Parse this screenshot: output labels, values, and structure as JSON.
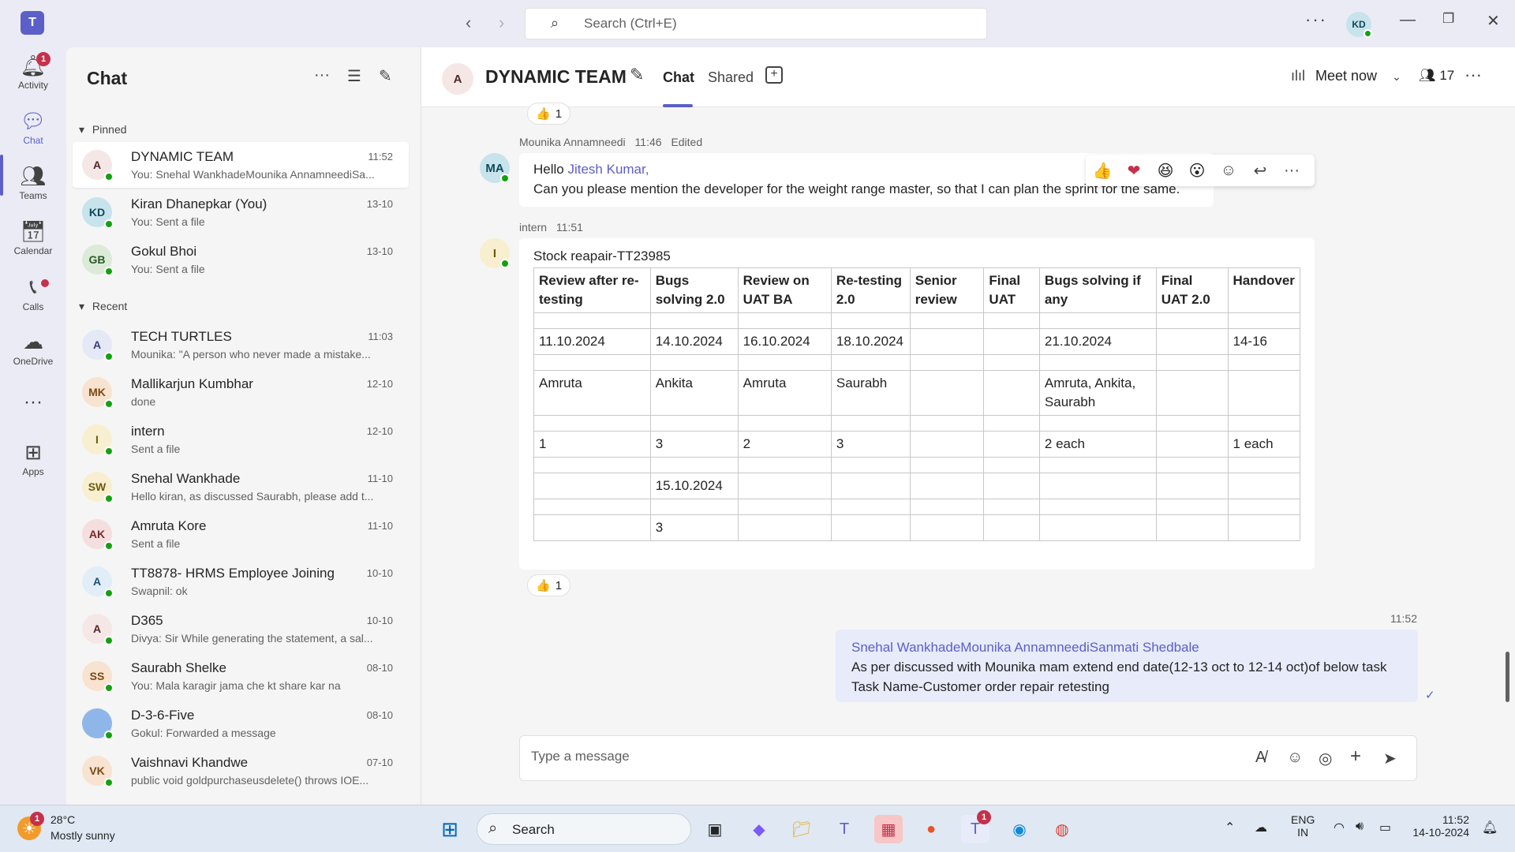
{
  "titlebar": {
    "search_placeholder": "Search (Ctrl+E)",
    "user_initials": "KD"
  },
  "rail": {
    "items": [
      {
        "label": "Activity",
        "badge": "1"
      },
      {
        "label": "Chat"
      },
      {
        "label": "Teams"
      },
      {
        "label": "Calendar"
      },
      {
        "label": "Calls"
      },
      {
        "label": "OneDrive"
      },
      {
        "label": "Apps"
      }
    ]
  },
  "chatlist": {
    "title": "Chat",
    "pinned_label": "Pinned",
    "recent_label": "Recent",
    "pinned": [
      {
        "initials": "A",
        "name": "DYNAMIC TEAM",
        "preview": "You: Snehal WankhadeMounika AnnamneediSa...",
        "time": "11:52",
        "bg": "#f6e7e7",
        "fg": "#4d2a2a"
      },
      {
        "initials": "KD",
        "name": "Kiran Dhanepkar (You)",
        "preview": "You: Sent a file",
        "time": "13-10",
        "bg": "#c7e3eb",
        "fg": "#0f4a5c"
      },
      {
        "initials": "GB",
        "name": "Gokul Bhoi",
        "preview": "You: Sent a file",
        "time": "13-10",
        "bg": "#dbebd8",
        "fg": "#2d5a27"
      }
    ],
    "recent": [
      {
        "initials": "A",
        "name": "TECH TURTLES",
        "preview": "Mounika: \"A person who never made a mistake...",
        "time": "11:03",
        "bg": "#e5e8f5",
        "fg": "#3b3f7a"
      },
      {
        "initials": "MK",
        "name": "Mallikarjun Kumbhar",
        "preview": "done",
        "time": "12-10",
        "bg": "#f7e3cf",
        "fg": "#7a4a14"
      },
      {
        "initials": "I",
        "name": "intern",
        "preview": "Sent a file",
        "time": "12-10",
        "bg": "#f7efcf",
        "fg": "#6e5a10"
      },
      {
        "initials": "SW",
        "name": "Snehal Wankhade",
        "preview": "Hello kiran, as discussed Saurabh, please add t...",
        "time": "11-10",
        "bg": "#f7efcf",
        "fg": "#6e5a10"
      },
      {
        "initials": "AK",
        "name": "Amruta Kore",
        "preview": "Sent a file",
        "time": "11-10",
        "bg": "#f5dede",
        "fg": "#7a2a2a"
      },
      {
        "initials": "A",
        "name": "TT8878- HRMS Employee Joining",
        "preview": "Swapnil: ok",
        "time": "10-10",
        "bg": "#e2eef7",
        "fg": "#1f4e7a"
      },
      {
        "initials": "A",
        "name": "D365",
        "preview": "Divya: Sir While generating the statement, a sal...",
        "time": "10-10",
        "bg": "#f6e7e7",
        "fg": "#4d2a2a"
      },
      {
        "initials": "SS",
        "name": "Saurabh Shelke",
        "preview": "You: Mala karagir jama che kt share kar na",
        "time": "08-10",
        "bg": "#f7e3cf",
        "fg": "#7a4a14"
      },
      {
        "initials": "",
        "name": "D-3-6-Five",
        "preview": "Gokul: Forwarded a message",
        "time": "08-10",
        "bg": "#8fb6e8",
        "fg": "#ffffff"
      },
      {
        "initials": "VK",
        "name": "Vaishnavi Khandwe",
        "preview": "public void goldpurchaseusdelete() throws IOE...",
        "time": "07-10",
        "bg": "#f7e3cf",
        "fg": "#7a4a14"
      }
    ]
  },
  "header": {
    "group_initial": "A",
    "group_name": "DYNAMIC TEAM",
    "tab_chat": "Chat",
    "tab_shared": "Shared",
    "meet_now": "Meet now",
    "participants": "17"
  },
  "messages": {
    "top_reaction_count": "1",
    "msg1": {
      "author": "Mounika Annamneedi",
      "time": "11:46",
      "edited": "Edited",
      "initials": "MA",
      "greeting": "Hello ",
      "mention": "Jitesh Kumar",
      "comma": ",",
      "body": "Can you please mention the developer for the weight range master, so that I can plan the sprint for the same."
    },
    "msg2": {
      "author": "intern",
      "time": "11:51",
      "initials": "I",
      "title": "Stock reapair-TT23985",
      "reaction_count": "1",
      "table_headers": [
        "Review after re-testing",
        "Bugs solving 2.0",
        "Review on UAT BA",
        "Re-testing 2.0",
        "Senior review",
        "Final UAT",
        "Bugs solving if any",
        "Final UAT 2.0",
        "Handover"
      ],
      "table_rows": [
        [
          "",
          "",
          "",
          "",
          "",
          "",
          "",
          "",
          ""
        ],
        [
          "11.10.2024",
          "14.10.2024",
          "16.10.2024",
          "18.10.2024",
          "",
          "",
          "21.10.2024",
          "",
          "14-16"
        ],
        [
          "",
          "",
          "",
          "",
          "",
          "",
          "",
          "",
          ""
        ],
        [
          "Amruta",
          "Ankita",
          "Amruta",
          "Saurabh",
          "",
          "",
          "Amruta, Ankita, Saurabh",
          "",
          ""
        ],
        [
          "",
          "",
          "",
          "",
          "",
          "",
          "",
          "",
          ""
        ],
        [
          "1",
          "3",
          "2",
          "3",
          "",
          "",
          "2 each",
          "",
          "1 each"
        ],
        [
          "",
          "",
          "",
          "",
          "",
          "",
          "",
          "",
          ""
        ],
        [
          "",
          "15.10.2024",
          "",
          "",
          "",
          "",
          "",
          "",
          ""
        ],
        [
          "",
          "",
          "",
          "",
          "",
          "",
          "",
          "",
          ""
        ],
        [
          "",
          "3",
          "",
          "",
          "",
          "",
          "",
          "",
          ""
        ]
      ]
    },
    "mine": {
      "time": "11:52",
      "mentions": "Snehal WankhadeMounika AnnamneediSanmati Shedbale",
      "line1": "As per discussed with Mounika mam extend end date(12-13 oct to 12-14 oct)of below task",
      "line2": "Task Name-Customer order repair retesting"
    }
  },
  "compose": {
    "placeholder": "Type a message"
  },
  "taskbar": {
    "temp": "28°C",
    "weather": "Mostly sunny",
    "weather_badge": "1",
    "search": "Search",
    "teams_badge": "1",
    "lang1": "ENG",
    "lang2": "IN",
    "time": "11:52",
    "date": "14-10-2024"
  }
}
